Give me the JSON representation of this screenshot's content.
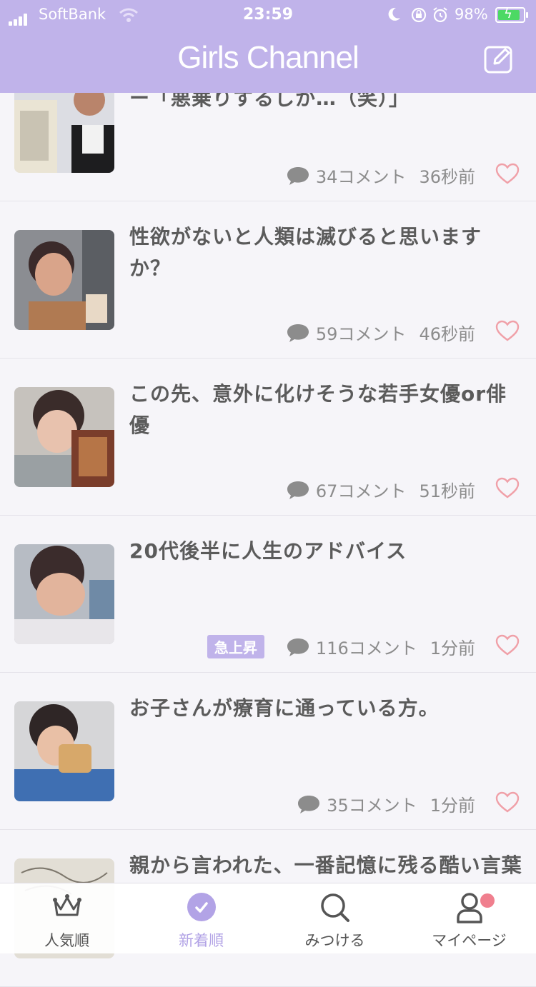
{
  "status_bar": {
    "carrier": "SoftBank",
    "time": "23:59",
    "battery": "98%"
  },
  "header": {
    "title": "Girls Channel"
  },
  "topics": [
    {
      "title": "付き弁当箱が爆誕　ネット反応にメーカー「悪乗りするしか…（笑）」",
      "comments": "34コメント",
      "time": "36秒前",
      "badge": ""
    },
    {
      "title": "性欲がないと人類は滅びると思いますか？",
      "comments": "59コメント",
      "time": "46秒前",
      "badge": ""
    },
    {
      "title": "この先、意外に化けそうな若手女優or俳優",
      "comments": "67コメント",
      "time": "51秒前",
      "badge": ""
    },
    {
      "title": "20代後半に人生のアドバイス",
      "comments": "116コメント",
      "time": "1分前",
      "badge": "急上昇"
    },
    {
      "title": "お子さんが療育に通っている方。",
      "comments": "35コメント",
      "time": "1分前",
      "badge": ""
    },
    {
      "title": "親から言われた、一番記憶に残る酷い言葉",
      "comments": "",
      "time": "",
      "badge": ""
    }
  ],
  "tabs": [
    {
      "label": "人気順",
      "icon": "crown-icon"
    },
    {
      "label": "新着順",
      "icon": "check-circle-icon"
    },
    {
      "label": "みつける",
      "icon": "search-icon"
    },
    {
      "label": "マイページ",
      "icon": "person-icon"
    }
  ],
  "colors": {
    "header": "#c0b3ea",
    "accent": "#b2a3e6",
    "heart": "#f0a0a8",
    "badge": "#c0b3ea",
    "notification": "#f07f8e"
  }
}
